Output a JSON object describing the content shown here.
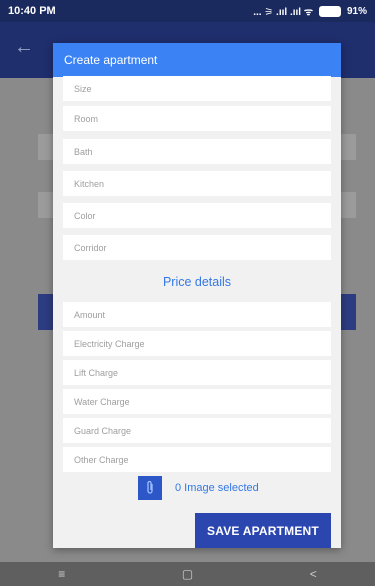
{
  "status_bar": {
    "time": "10:40 PM",
    "signal": "... ⚞ .ııl .ııl ᯤ",
    "battery": "91%"
  },
  "dialog": {
    "title": "Create apartment",
    "fields": {
      "size": "Size",
      "room": "Room",
      "bath": "Bath",
      "kitchen": "Kitchen",
      "color": "Color",
      "corridor": "Corridor"
    },
    "price_section_title": "Price details",
    "price_fields": {
      "amount": "Amount",
      "electricity": "Electricity Charge",
      "lift": "Lift Charge",
      "water": "Water Charge",
      "guard": "Guard Charge",
      "other": "Other Charge"
    },
    "image_status": "0 Image selected",
    "save_label": "SAVE APARTMENT"
  },
  "nav": {
    "menu": "≡",
    "home": "▢",
    "back": "<"
  },
  "icons": [
    "back-arrow-icon",
    "paperclip-icon",
    "battery-icon",
    "menu-icon",
    "home-icon",
    "back-icon"
  ],
  "colors": {
    "header": "#3b82f5",
    "save": "#2c46b0",
    "accent": "#3578e5"
  }
}
